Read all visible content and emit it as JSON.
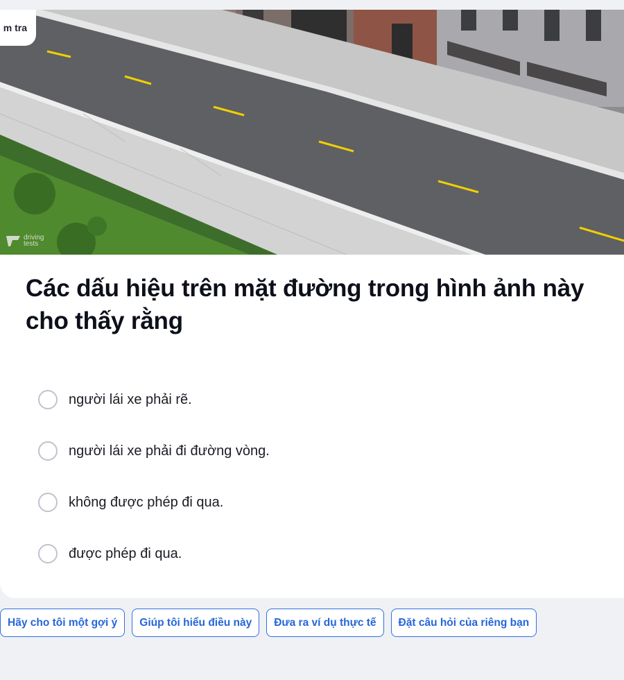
{
  "header": {
    "tab_partial_label": "m tra"
  },
  "scene": {
    "watermark_line1": "driving",
    "watermark_line2": "tests"
  },
  "question": {
    "text": "Các dấu hiệu trên mặt đường trong hình ảnh này cho thấy rằng"
  },
  "options": [
    {
      "label": "người lái xe phải rẽ."
    },
    {
      "label": "người lái xe phải đi đường vòng."
    },
    {
      "label": "không được phép đi qua."
    },
    {
      "label": "được phép đi qua."
    }
  ],
  "help_chips": [
    {
      "label": "Hãy cho tôi một gợi ý"
    },
    {
      "label": "Giúp tôi hiểu điều này"
    },
    {
      "label": "Đưa ra ví dụ thực tế"
    },
    {
      "label": "Đặt câu hỏi của riêng bạn"
    }
  ],
  "colors": {
    "accent": "#2566d9",
    "road": "#5f6063",
    "lane_marking": "#f0d000",
    "grass": "#4f8a2e",
    "page_bg": "#f0f1f5"
  }
}
